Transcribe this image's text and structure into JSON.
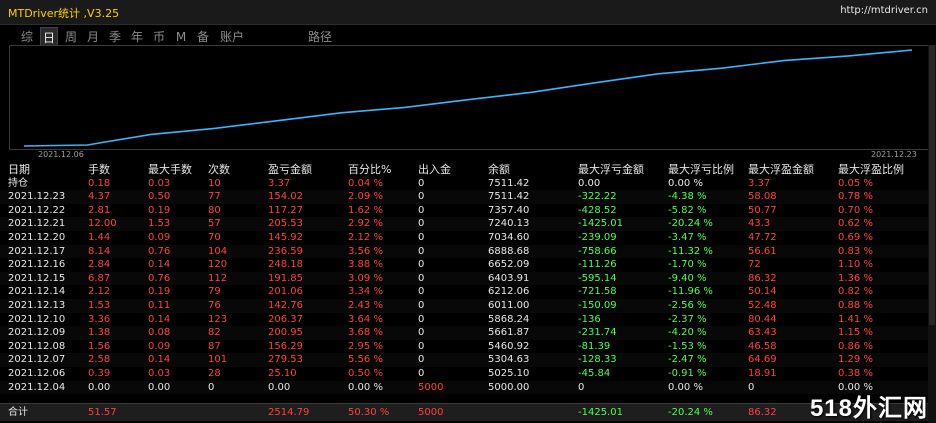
{
  "window": {
    "title": "MTDriver统计 ,V3.25",
    "url": "http://mtdriver.cn"
  },
  "tabs": [
    "综",
    "日",
    "周",
    "月",
    "季",
    "年",
    "币",
    "M",
    "备",
    "账户",
    "路径"
  ],
  "active_tab": "日",
  "chart": {
    "start_label": "2021.12.06",
    "end_label": "2021.12.23",
    "line_color": "#3ab4ff",
    "balance_series": [
      5000.0,
      5025.1,
      5304.63,
      5460.92,
      5661.87,
      5868.24,
      6011.0,
      6212.06,
      6403.91,
      6652.09,
      6888.68,
      7034.6,
      7240.13,
      7357.4,
      7511.42
    ]
  },
  "columns": [
    "日期",
    "手数",
    "最大手数",
    "次数",
    "盈亏金额",
    "百分比%",
    "出入金",
    "余额",
    "最大浮亏金额",
    "最大浮亏比例",
    "最大浮盈金额",
    "最大浮盈比例"
  ],
  "rows": [
    [
      "持仓",
      "0.18",
      "0.03",
      "10",
      "3.37",
      "0.04 %",
      "0",
      "7511.42",
      "0.00",
      "0.00 %",
      "3.37",
      "0.05 %"
    ],
    [
      "2021.12.23",
      "4.37",
      "0.50",
      "77",
      "154.02",
      "2.09 %",
      "0",
      "7511.42",
      "-322.22",
      "-4.38 %",
      "58.08",
      "0.78 %"
    ],
    [
      "2021.12.22",
      "2.81",
      "0.19",
      "80",
      "117.27",
      "1.62 %",
      "0",
      "7357.40",
      "-428.52",
      "-5.82 %",
      "50.77",
      "0.70 %"
    ],
    [
      "2021.12.21",
      "12.00",
      "1.53",
      "57",
      "205.53",
      "2.92 %",
      "0",
      "7240.13",
      "-1425.01",
      "-20.24 %",
      "43.3",
      "0.62 %"
    ],
    [
      "2021.12.20",
      "1.44",
      "0.09",
      "70",
      "145.92",
      "2.12 %",
      "0",
      "7034.60",
      "-239.09",
      "-3.47 %",
      "47.72",
      "0.69 %"
    ],
    [
      "2021.12.17",
      "8.14",
      "0.76",
      "104",
      "236.59",
      "3.56 %",
      "0",
      "6888.68",
      "-758.66",
      "-11.32 %",
      "56.61",
      "0.83 %"
    ],
    [
      "2021.12.16",
      "2.84",
      "0.14",
      "120",
      "248.18",
      "3.88 %",
      "0",
      "6652.09",
      "-111.26",
      "-1.70 %",
      "72",
      "1.10 %"
    ],
    [
      "2021.12.15",
      "6.87",
      "0.76",
      "112",
      "191.85",
      "3.09 %",
      "0",
      "6403.91",
      "-595.14",
      "-9.40 %",
      "86.32",
      "1.36 %"
    ],
    [
      "2021.12.14",
      "2.12",
      "0.19",
      "79",
      "201.06",
      "3.34 %",
      "0",
      "6212.06",
      "-721.58",
      "-11.96 %",
      "50.14",
      "0.82 %"
    ],
    [
      "2021.12.13",
      "1.53",
      "0.11",
      "76",
      "142.76",
      "2.43 %",
      "0",
      "6011.00",
      "-150.09",
      "-2.56 %",
      "52.48",
      "0.88 %"
    ],
    [
      "2021.12.10",
      "3.36",
      "0.14",
      "123",
      "206.37",
      "3.64 %",
      "0",
      "5868.24",
      "-136",
      "-2.37 %",
      "80.44",
      "1.41 %"
    ],
    [
      "2021.12.09",
      "1.38",
      "0.08",
      "82",
      "200.95",
      "3.68 %",
      "0",
      "5661.87",
      "-231.74",
      "-4.20 %",
      "63.43",
      "1.15 %"
    ],
    [
      "2021.12.08",
      "1.56",
      "0.09",
      "87",
      "156.29",
      "2.95 %",
      "0",
      "5460.92",
      "-81.39",
      "-1.53 %",
      "46.58",
      "0.86 %"
    ],
    [
      "2021.12.07",
      "2.58",
      "0.14",
      "101",
      "279.53",
      "5.56 %",
      "0",
      "5304.63",
      "-128.33",
      "-2.47 %",
      "64.69",
      "1.29 %"
    ],
    [
      "2021.12.06",
      "0.39",
      "0.03",
      "28",
      "25.10",
      "0.50 %",
      "0",
      "5025.10",
      "-45.84",
      "-0.91 %",
      "18.91",
      "0.38 %"
    ],
    [
      "2021.12.04",
      "0.00",
      "0.00",
      "0",
      "0.00",
      "0.00 %",
      "5000",
      "5000.00",
      "0",
      "0.00 %",
      "0",
      "0.00 %"
    ]
  ],
  "total": [
    "合计",
    "51.57",
    "",
    "",
    "2514.79",
    "50.30 %",
    "5000",
    "",
    "-1425.01",
    "-20.24 %",
    "86.32",
    ""
  ],
  "watermark": "518外汇网"
}
